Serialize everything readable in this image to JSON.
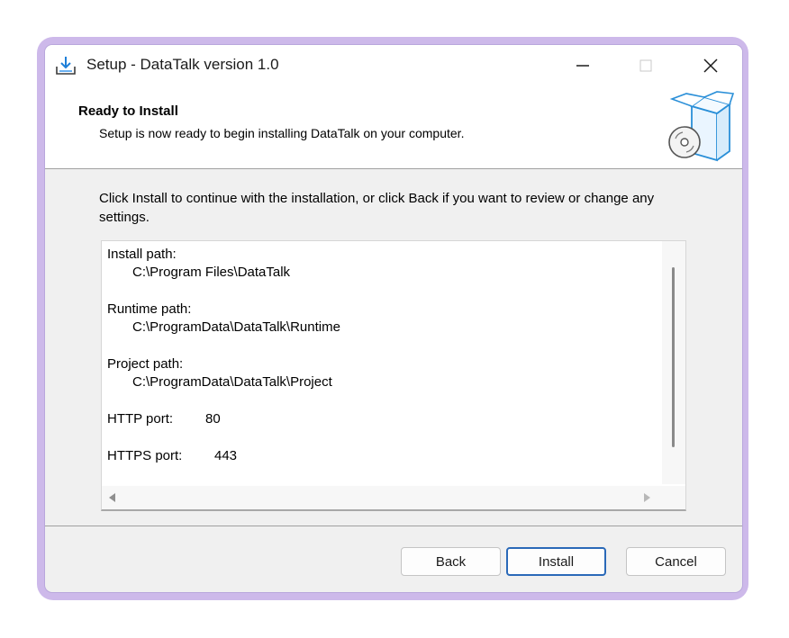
{
  "window": {
    "title": "Setup - DataTalk version 1.0",
    "icon": "setup-install-icon",
    "controls": [
      "minimize",
      "maximize",
      "close"
    ]
  },
  "header": {
    "title": "Ready to Install",
    "subtitle": "Setup is now ready to begin installing DataTalk on your computer.",
    "icon": "box-disc-icon"
  },
  "intro": "Click Install to continue with the installation, or click Back if you want to review or change any settings.",
  "memo": {
    "install_path_label": "Install path:",
    "install_path_value": "C:\\Program Files\\DataTalk",
    "runtime_path_label": "Runtime path:",
    "runtime_path_value": "C:\\ProgramData\\DataTalk\\Runtime",
    "project_path_label": "Project path:",
    "project_path_value": "C:\\ProgramData\\DataTalk\\Project",
    "http_port_label": "HTTP port:",
    "http_port_value": "80",
    "https_port_label": "HTTPS port:",
    "https_port_value": "443"
  },
  "buttons": {
    "back": "Back",
    "install": "Install",
    "cancel": "Cancel"
  },
  "colors": {
    "accent": "#2a69b8",
    "frame": "#cdb9ea",
    "window_bg": "#f0f0f0"
  }
}
